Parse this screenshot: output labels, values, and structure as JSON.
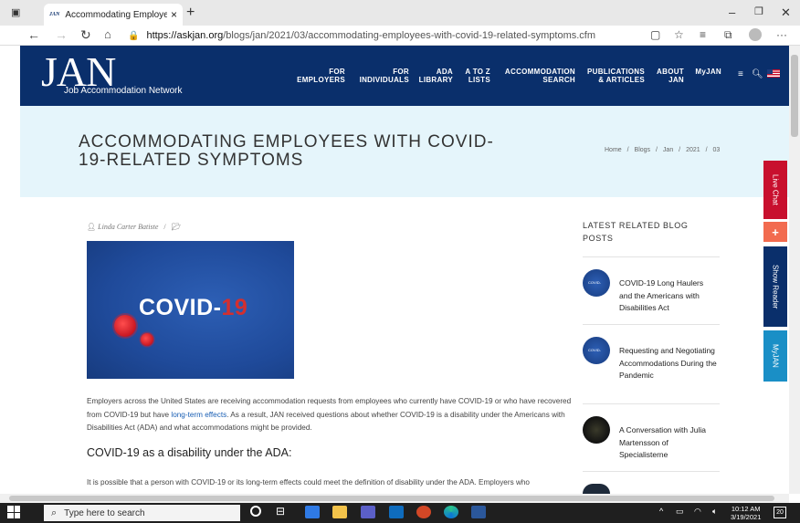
{
  "browser": {
    "tab_title": "Accommodating Employees with",
    "tab_favicon": "JAN",
    "url_domain": "https://askjan.org",
    "url_path": "/blogs/jan/2021/03/accommodating-employees-with-covid-19-related-symptoms.cfm",
    "icons": [
      "back-icon",
      "forward-icon",
      "refresh-icon",
      "home-icon",
      "lock-icon",
      "reader-icon",
      "favorite-icon",
      "favorites-icon",
      "collections-icon",
      "profile-icon",
      "more-icon"
    ]
  },
  "site": {
    "logo": "JAN",
    "logo_sub": "Job Accommodation Network",
    "nav": [
      {
        "l1": "FOR",
        "l2": "EMPLOYERS"
      },
      {
        "l1": "FOR",
        "l2": "INDIVIDUALS"
      },
      {
        "l1": "ADA",
        "l2": "LIBRARY"
      },
      {
        "l1": "A TO Z",
        "l2": "LISTS"
      },
      {
        "l1": "ACCOMMODATION",
        "l2": "SEARCH"
      },
      {
        "l1": "PUBLICATIONS",
        "l2": "& ARTICLES"
      },
      {
        "l1": "ABOUT",
        "l2": "JAN"
      },
      {
        "l1": "",
        "l2": "MyJAN"
      }
    ]
  },
  "page": {
    "title": "ACCOMMODATING EMPLOYEES WITH COVID-19-RELATED SYMPTOMS",
    "breadcrumbs": [
      "Home",
      "/",
      "Blogs",
      "/",
      "Jan",
      "/",
      "2021",
      "/",
      "03"
    ],
    "author": "Linda Carter Batiste",
    "hero_text": "COVID-",
    "hero_num": "19",
    "intro_pre": "Employers across the United States are receiving accommodation requests from employees who currently have COVID-19 or who have recovered from COVID-19 but have ",
    "intro_link": "long-term effects",
    "intro_post": ". As a result, JAN received questions about whether COVID-19 is a disability under the Americans with Disabilities Act (ADA) and what accommodations might be provided.",
    "section_heading": "COVID-19 as a disability under the ADA:",
    "section_para": "It is possible that a person with COVID-19 or its long-term effects could meet the definition of disability under the ADA. Employers who"
  },
  "sidebar": {
    "heading": "LATEST RELATED BLOG POSTS",
    "posts": [
      {
        "title": "COVID-19 Long Haulers and the Americans with Disabilities Act",
        "color": "#2148a0"
      },
      {
        "title": "Requesting and Negotiating Accommodations During the Pandemic",
        "color": "#2148a0"
      },
      {
        "title": "A Conversation with Julia Martensson of Specialisterne",
        "color": "#1a1a1a"
      }
    ]
  },
  "float_tabs": {
    "live_chat": "Live Chat",
    "plus": "+",
    "show_reader": "Show Reader",
    "myjan": "MyJAN"
  },
  "taskbar": {
    "search_placeholder": "Type here to search",
    "time": "10:12 AM",
    "date": "3/19/2021",
    "notif_count": "20"
  },
  "colors": {
    "brand_navy": "#0a2f6b",
    "title_band": "#e5f5fb",
    "live_chat": "#c8102e",
    "plus": "#f26b4f",
    "show_reader": "#0a2f6b",
    "myjan": "#1a8fc6"
  }
}
